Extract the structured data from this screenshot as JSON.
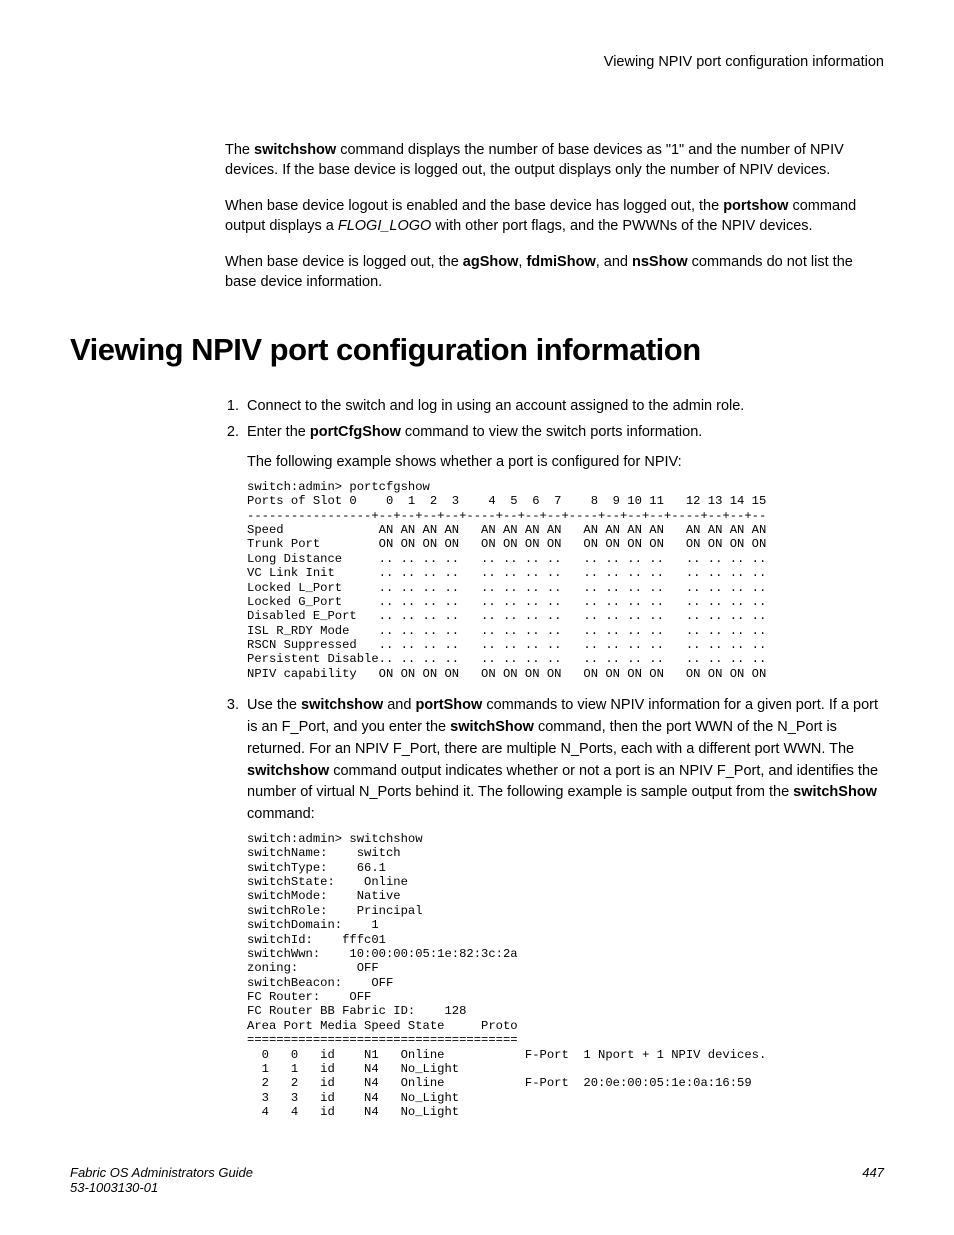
{
  "running_head": "Viewing NPIV port configuration information",
  "intro": {
    "p1_a": "The ",
    "p1_b": "switchshow",
    "p1_c": " command displays the number of base devices as \"1\" and the number of NPIV devices. If the base device is logged out, the output displays only the number of NPIV devices.",
    "p2_a": "When base device logout is enabled and the base device has logged out, the ",
    "p2_b": "portshow",
    "p2_c": " command output displays a ",
    "p2_d": "FLOGI_LOGO",
    "p2_e": " with other port flags, and the PWWNs of the NPIV devices.",
    "p3_a": "When base device is logged out, the ",
    "p3_b": "agShow",
    "p3_c": ", ",
    "p3_d": "fdmiShow",
    "p3_e": ", and ",
    "p3_f": "nsShow",
    "p3_g": " commands do not list the base device information."
  },
  "heading": "Viewing NPIV port configuration information",
  "steps": {
    "s1": "Connect to the switch and log in using an account assigned to the admin role.",
    "s2_a": "Enter the ",
    "s2_b": "portCfgShow",
    "s2_c": " command to view the switch ports information.",
    "s2_follow": "The following example shows whether a port is configured for NPIV:",
    "s3_a": "Use the ",
    "s3_b": "switchshow",
    "s3_c": " and ",
    "s3_d": "portShow",
    "s3_e": " commands to view NPIV information for a given port. If a port is an F_Port, and you enter the ",
    "s3_f": "switchShow",
    "s3_g": " command, then the port WWN of the N_Port is returned. For an NPIV F_Port, there are multiple N_Ports, each with a different port WWN. The ",
    "s3_h": "switchshow",
    "s3_i": " command output indicates whether or not a port is an NPIV F_Port, and identifies the number of virtual N_Ports behind it. The following example is sample output from the ",
    "s3_j": "switchShow",
    "s3_k": " command:"
  },
  "code1": "switch:admin> portcfgshow\nPorts of Slot 0    0  1  2  3    4  5  6  7    8  9 10 11   12 13 14 15\n-----------------+--+--+--+--+----+--+--+--+----+--+--+--+----+--+--+--\nSpeed             AN AN AN AN   AN AN AN AN   AN AN AN AN   AN AN AN AN\nTrunk Port        ON ON ON ON   ON ON ON ON   ON ON ON ON   ON ON ON ON\nLong Distance     .. .. .. ..   .. .. .. ..   .. .. .. ..   .. .. .. ..\nVC Link Init      .. .. .. ..   .. .. .. ..   .. .. .. ..   .. .. .. ..\nLocked L_Port     .. .. .. ..   .. .. .. ..   .. .. .. ..   .. .. .. ..\nLocked G_Port     .. .. .. ..   .. .. .. ..   .. .. .. ..   .. .. .. ..\nDisabled E_Port   .. .. .. ..   .. .. .. ..   .. .. .. ..   .. .. .. ..\nISL R_RDY Mode    .. .. .. ..   .. .. .. ..   .. .. .. ..   .. .. .. ..\nRSCN Suppressed   .. .. .. ..   .. .. .. ..   .. .. .. ..   .. .. .. ..\nPersistent Disable.. .. .. ..   .. .. .. ..   .. .. .. ..   .. .. .. ..\nNPIV capability   ON ON ON ON   ON ON ON ON   ON ON ON ON   ON ON ON ON",
  "code2": "switch:admin> switchshow\nswitchName:    switch\nswitchType:    66.1\nswitchState:    Online   \nswitchMode:    Native\nswitchRole:    Principal\nswitchDomain:    1\nswitchId:    fffc01\nswitchWwn:    10:00:00:05:1e:82:3c:2a\nzoning:        OFF\nswitchBeacon:    OFF\nFC Router:    OFF\nFC Router BB Fabric ID:    128\nArea Port Media Speed State     Proto\n=====================================\n  0   0   id    N1   Online           F-Port  1 Nport + 1 NPIV devices.\n  1   1   id    N4   No_Light         \n  2   2   id    N4   Online           F-Port  20:0e:00:05:1e:0a:16:59\n  3   3   id    N4   No_Light         \n  4   4   id    N4   No_Light",
  "footer": {
    "left1": "Fabric OS Administrators Guide",
    "left2": "53-1003130-01",
    "right": "447"
  }
}
